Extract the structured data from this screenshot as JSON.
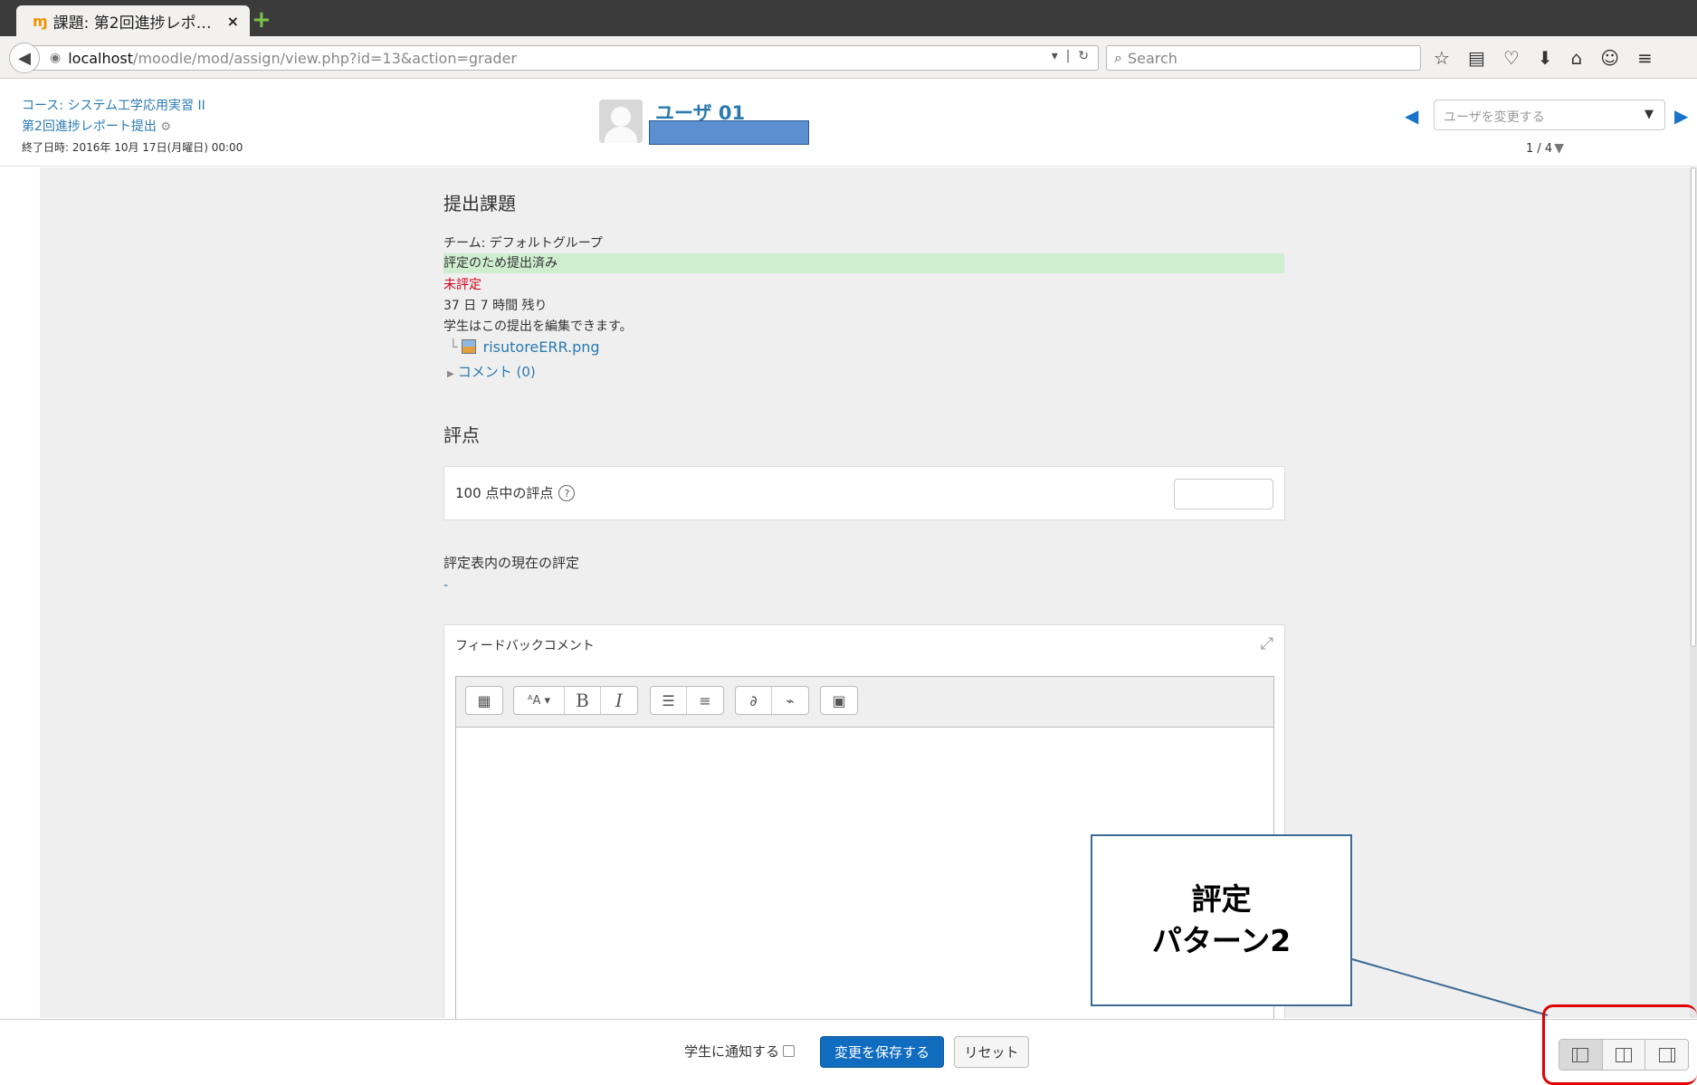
{
  "browser": {
    "tab_title": "課題: 第2回進捗レポ…",
    "tab_close": "×",
    "new_tab": "+",
    "url_host": "localhost",
    "url_path": "/moodle/mod/assign/view.php?id=13&action=grader",
    "search_placeholder": "Search"
  },
  "header": {
    "course_link": "コース: システム工学応用実習 II",
    "assignment_link": "第2回進捗レポート提出",
    "due_date": "終了日時: 2016年 10月 17日(月曜日) 00:00",
    "user_name": "ユーザ 01",
    "change_user_placeholder": "ユーザを変更する",
    "user_count": "1 / 4"
  },
  "submission": {
    "section_title": "提出課題",
    "team": "チーム: デフォルトグループ",
    "status": "評定のため提出済み",
    "grading_status": "未評定",
    "time_remaining": "37 日 7 時間 残り",
    "editable_note": "学生はこの提出を編集できます。",
    "file_name": "risutoreERR.png",
    "comments_link": "コメント (0)"
  },
  "grade": {
    "section_title": "評点",
    "grade_label": "100 点中の評点",
    "grade_value": "",
    "gradebook_label": "評定表内の現在の評定",
    "gradebook_value": "-"
  },
  "feedback": {
    "title": "フィードバックコメント"
  },
  "footer": {
    "notify_label": "学生に通知する",
    "save_label": "変更を保存する",
    "reset_label": "リセット"
  },
  "annotation": {
    "line1": "評定",
    "line2": "パターン2",
    "border_color": "#3a6a95",
    "highlight_color": "#e00000"
  },
  "colors": {
    "link": "#2a7ab0",
    "primary_button": "#0f6cbf",
    "status_green": "#cfedcf",
    "status_red": "#d0021b"
  }
}
